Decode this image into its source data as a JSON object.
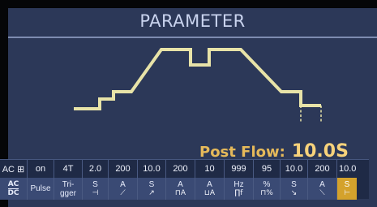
{
  "screen": {
    "title": "PARAMETER",
    "readout": {
      "label": "Post Flow:",
      "value": "10.0S"
    }
  },
  "values_row": [
    "AC ⊞",
    "on",
    "4T",
    "2.0",
    "200",
    "10.0",
    "200",
    "10",
    "999",
    "95",
    "10.0",
    "200",
    "10.0"
  ],
  "icons_row": [
    {
      "top": "AC",
      "bottom": "DC",
      "icon": "ac-dc-icon",
      "kind": "acdc"
    },
    {
      "top": "Pulse",
      "bottom": "",
      "icon": "pulse-icon"
    },
    {
      "top": "Tri-",
      "bottom": "gger",
      "icon": "trigger-icon"
    },
    {
      "top": "S",
      "bottom": "⊣",
      "icon": "pre-flow-icon"
    },
    {
      "top": "A",
      "bottom": "⟋",
      "icon": "start-current-icon"
    },
    {
      "top": "S",
      "bottom": "↗",
      "icon": "upslope-icon"
    },
    {
      "top": "A",
      "bottom": "⊓A",
      "icon": "peak-current-icon"
    },
    {
      "top": "A",
      "bottom": "⊔A",
      "icon": "base-current-icon"
    },
    {
      "top": "Hz",
      "bottom": "∏f",
      "icon": "pulse-frequency-icon"
    },
    {
      "top": "%",
      "bottom": "⊓%",
      "icon": "balance-icon"
    },
    {
      "top": "S",
      "bottom": "↘",
      "icon": "downslope-icon"
    },
    {
      "top": "A",
      "bottom": "⟍",
      "icon": "crater-current-icon"
    },
    {
      "top": "S",
      "bottom": "⊢",
      "icon": "post-flow-icon",
      "active": true
    }
  ],
  "colors": {
    "screen_bg": "#2c3858",
    "waveform": "#e8e3a8",
    "title": "#c9d3ee",
    "readout": "#f7d27b",
    "active_cell": "#d4a22c"
  }
}
